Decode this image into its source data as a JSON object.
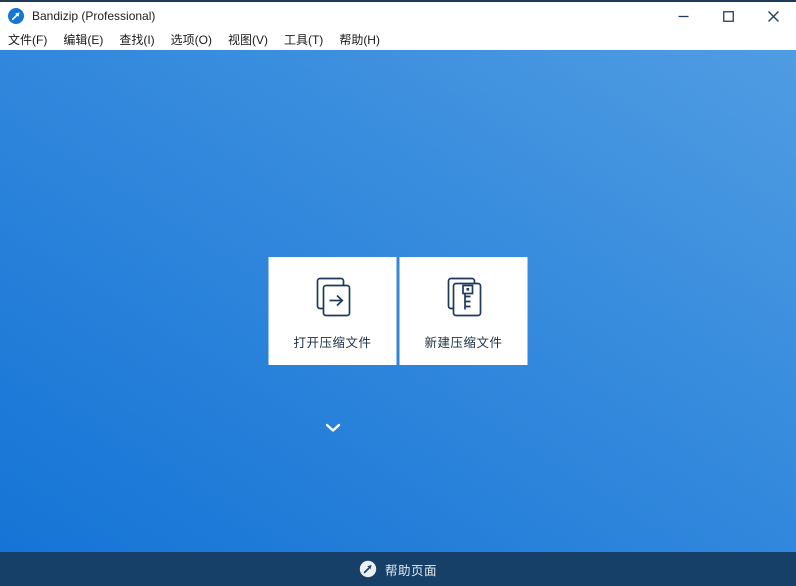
{
  "window": {
    "title": "Bandizip (Professional)",
    "app_icon": "bandizip-logo-icon"
  },
  "titlebar": {
    "controls": [
      {
        "name": "minimize",
        "icon": "minimize-icon"
      },
      {
        "name": "maximize",
        "icon": "maximize-icon"
      },
      {
        "name": "close",
        "icon": "close-icon"
      }
    ]
  },
  "menubar": {
    "items": [
      "文件(F)",
      "编辑(E)",
      "查找(I)",
      "选项(O)",
      "视图(V)",
      "工具(T)",
      "帮助(H)"
    ]
  },
  "main": {
    "cards": [
      {
        "label": "打开压缩文件",
        "icon": "open-archive-icon"
      },
      {
        "label": "新建压缩文件",
        "icon": "new-archive-icon"
      }
    ],
    "more_indicator": "chevron-down-icon"
  },
  "statusbar": {
    "help_label": "帮助页面",
    "icon": "help-logo-icon"
  },
  "colors": {
    "accent_blue": "#1677d2",
    "background_gradient_top_right": "#4f9ce2",
    "background_gradient_bottom_left": "#1574d6",
    "statusbar_background": "#174069",
    "card_background": "#ffffff",
    "icon_stroke": "#1e3a5a",
    "window_control_glyph": "#1d3c63",
    "title_text": "#1f1f1f",
    "top_border": "#1c3a5a"
  }
}
